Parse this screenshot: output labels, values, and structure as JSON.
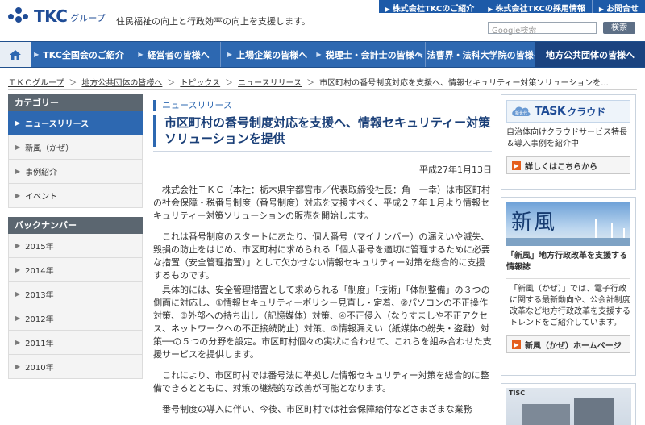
{
  "header": {
    "logo_text": "TKC",
    "logo_sub": "グループ",
    "tagline": "住民福祉の向上と行政効率の向上を支援します。",
    "top_links": [
      "株式会社TKCのご紹介",
      "株式会社TKCの採用情報",
      "お問合せ"
    ],
    "search_placeholder": "Google検索",
    "search_button": "検索"
  },
  "gnav": {
    "items": [
      "TKC全国会のご紹介",
      "経営者の皆様へ",
      "上場企業の皆様へ",
      "税理士・会計士の皆様へ",
      "法曹界・法科大学院の皆様へ",
      "地方公共団体の皆様へ"
    ],
    "active_index": 5
  },
  "breadcrumb": [
    "ＴＫＣグループ",
    "地方公共団体の皆様へ",
    "トピックス",
    "ニュースリリース",
    "市区町村の番号制度対応を支援へ、情報セキュリティー対策ソリューションを..."
  ],
  "sidebar": {
    "category_title": "カテゴリー",
    "categories": [
      "ニュースリリース",
      "新風（かぜ）",
      "事例紹介",
      "イベント"
    ],
    "active_index": 0,
    "backnumber_title": "バックナンバー",
    "years": [
      "2015年",
      "2014年",
      "2013年",
      "2012年",
      "2011年",
      "2010年"
    ]
  },
  "article": {
    "label": "ニュースリリース",
    "title": "市区町村の番号制度対応を支援へ、情報セキュリティー対策ソリューションを提供",
    "date": "平成27年1月13日",
    "paragraphs": [
      "株式会社ＴＫＣ（本社：栃木県宇都宮市／代表取締役社長：角　一幸）は市区町村の社会保障・税番号制度（番号制度）対応を支援すべく、平成２７年１月より情報セキュリティー対策ソリューションの販売を開始します。",
      "これは番号制度のスタートにあたり、個人番号（マイナンバー）の漏えいや滅失、毀損の防止をはじめ、市区町村に求められる「個人番号を適切に管理するために必要な措置（安全管理措置）」として欠かせない情報セキュリティー対策を総合的に支援するものです。",
      "具体的には、安全管理措置として求められる「制度」「技術」「体制整備」の３つの側面に対応し、①情報セキュリティーポリシー見直し・定着、②パソコンの不正操作対策、③外部への持ち出し（記憶媒体）対策、④不正侵入（なりすましや不正アクセス、ネットワークへの不正接続防止）対策、⑤情報漏えい（紙媒体の紛失・盗難）対策──の５つの分野を設定。市区町村個々の実状に合わせて、これらを組み合わせた支援サービスを提供します。",
      "これにより、市区町村では番号法に準拠した情報セキュリティー対策を総合的に整備できるとともに、対策の継続的な改善が可能となります。",
      "番号制度の導入に伴い、今後、市区町村では社会保障給付などさまざまな業務"
    ]
  },
  "right": {
    "task": {
      "logo_small": "新世代",
      "logo_word": "TASK",
      "logo_kana": "クラウド",
      "text": "自治体向けクラウドサービス特長＆導入事例を紹介中",
      "button": "詳しくはこちらから"
    },
    "fuufu": {
      "kanji": "新風",
      "title": "「新風」地方行政改革を支援する情報誌",
      "text": "「新風（かぜ）」では、電子行政に関する最新動向や、公会計制度改革など地方行政改革を支援するトレンドをご紹介しています。",
      "button": "新風（かぜ）ホームページ"
    },
    "tisc": {
      "label": "TISC"
    }
  }
}
